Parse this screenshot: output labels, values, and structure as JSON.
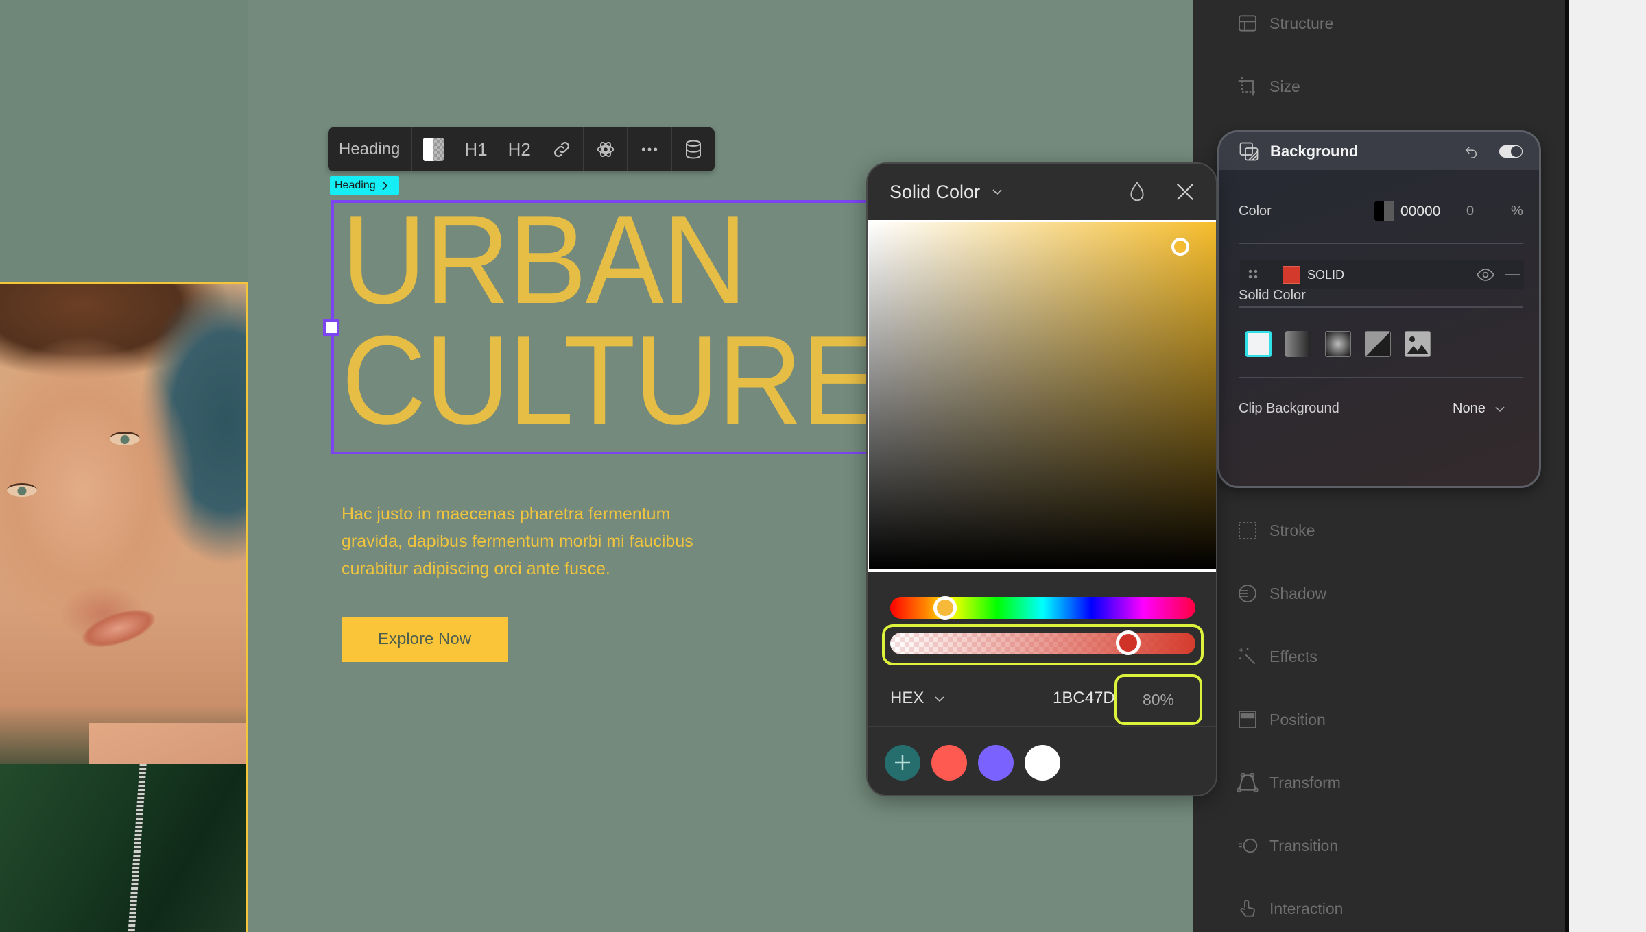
{
  "canvas": {
    "heading_lines": [
      "URBAN",
      "CULTURE"
    ],
    "body_text": "Hac justo in maecenas pharetra fermentum gravida, dapibus fermentum morbi mi faucibus curabitur adipiscing orci ante fusce.",
    "cta_label": "Explore Now",
    "selection_badge": "Heading",
    "colors": {
      "background": "#738a7c",
      "heading": "#e6bd45",
      "accent": "#fbc53a",
      "selection": "#7b45f2"
    }
  },
  "toolbar": {
    "element_type": "Heading",
    "h1_label": "H1",
    "h2_label": "H2",
    "icons": [
      "color-swatch-icon",
      "link-icon",
      "ai-openai-icon",
      "more-icon",
      "database-icon"
    ]
  },
  "color_picker": {
    "mode": "Solid Color",
    "format": "HEX",
    "hex_value": "1BC47D",
    "alpha": "80%",
    "hue_position": 0.18,
    "alpha_position": 0.78,
    "preset_swatches": [
      "#ff5a52",
      "#7a62ff",
      "#ffffff"
    ],
    "add_swatch_color": "#266d6d",
    "highlight_color": "#dcf23b"
  },
  "panel": {
    "nav_top": [
      {
        "label": "Structure",
        "icon": "structure-icon"
      },
      {
        "label": "Size",
        "icon": "size-icon"
      }
    ],
    "nav_bottom": [
      {
        "label": "Stroke",
        "icon": "stroke-icon"
      },
      {
        "label": "Shadow",
        "icon": "shadow-icon"
      },
      {
        "label": "Effects",
        "icon": "effects-icon"
      },
      {
        "label": "Position",
        "icon": "position-icon"
      },
      {
        "label": "Transform",
        "icon": "transform-icon"
      },
      {
        "label": "Transition",
        "icon": "transition-icon"
      },
      {
        "label": "Interaction",
        "icon": "interaction-icon"
      }
    ],
    "background": {
      "title": "Background",
      "enabled": true,
      "color_label": "Color",
      "color_value": "00000",
      "opacity_value": "0",
      "opacity_unit": "%",
      "layer_type": "SOLID",
      "layer_color": "#d33a2c",
      "solid_color_label": "Solid Color",
      "fill_types": [
        "solid",
        "linear-gradient",
        "radial-gradient",
        "conic-gradient",
        "image"
      ],
      "clip_label": "Clip Background",
      "clip_value": "None"
    }
  }
}
